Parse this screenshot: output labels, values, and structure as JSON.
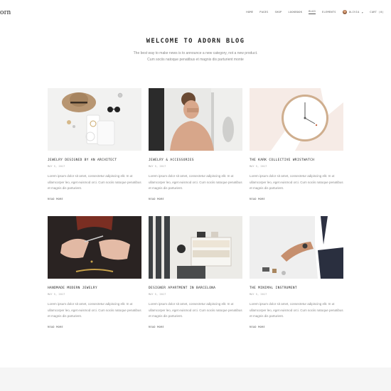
{
  "header": {
    "logo": "orn",
    "nav": [
      "HOME",
      "PAGES",
      "SHOP",
      "LOOKBOOK",
      "BLOG",
      "ELEMENTS"
    ],
    "active_nav": "BLOG",
    "user": "OLIVIA",
    "cart": "CART (0)"
  },
  "hero": {
    "title": "WELCOME TO ADORN BLOG",
    "subtitle_line1": "The best way to make news is to announce a new category, not a new product.",
    "subtitle_line2": "Cum sociis natoque penatibus et magnis dis parturient monte"
  },
  "posts": [
    {
      "title": "JEWELRY DESIGNED BY AN ARCHITECT",
      "date": "MAY 5, 2017",
      "excerpt": "Lorem ipsum dolor sit amet, consectetur adipiscing elit. In ut ullamcorper leo, eget euismod orci. Cum sociis natoque penatibus et magnis dis parturient.",
      "read_more": "READ MORE"
    },
    {
      "title": "JEWELRY & ACCESSORIES",
      "date": "MAY 5, 2017",
      "excerpt": "Lorem ipsum dolor sit amet, consectetur adipiscing elit. In ut ullamcorper leo, eget euismod orci. Cum sociis natoque penatibus et magnis dis parturient.",
      "read_more": "READ MORE"
    },
    {
      "title": "THE KARK COLLECTIVE WRISTWATCH",
      "date": "MAY 5, 2017",
      "excerpt": "Lorem ipsum dolor sit amet, consectetur adipiscing elit. In ut ullamcorper leo, eget euismod orci. Cum sociis natoque penatibus et magnis dis parturient.",
      "read_more": "READ MORE"
    },
    {
      "title": "HANDMADE MODERN JEWELRY",
      "date": "MAY 5, 2017",
      "excerpt": "Lorem ipsum dolor sit amet, consectetur adipiscing elit. In ut ullamcorper leo, eget euismod orci. Cum sociis natoque penatibus et magnis dis parturient.",
      "read_more": "READ MORE"
    },
    {
      "title": "DESIGNER APARTMENT IN BARCELONA",
      "date": "MAY 5, 2017",
      "excerpt": "Lorem ipsum dolor sit amet, consectetur adipiscing elit. In ut ullamcorper leo, eget euismod orci. Cum sociis natoque penatibus et magnis dis parturient.",
      "read_more": "READ MORE"
    },
    {
      "title": "THE MINIMAL INSTRUMENT",
      "date": "MAY 5, 2017",
      "excerpt": "Lorem ipsum dolor sit amet, consectetur adipiscing elit. In ut ullamcorper leo, eget euismod orci. Cum sociis natoque penatibus et magnis dis parturient.",
      "read_more": "READ MORE"
    }
  ],
  "icons": {
    "user_caret": "chevron-down-icon"
  }
}
